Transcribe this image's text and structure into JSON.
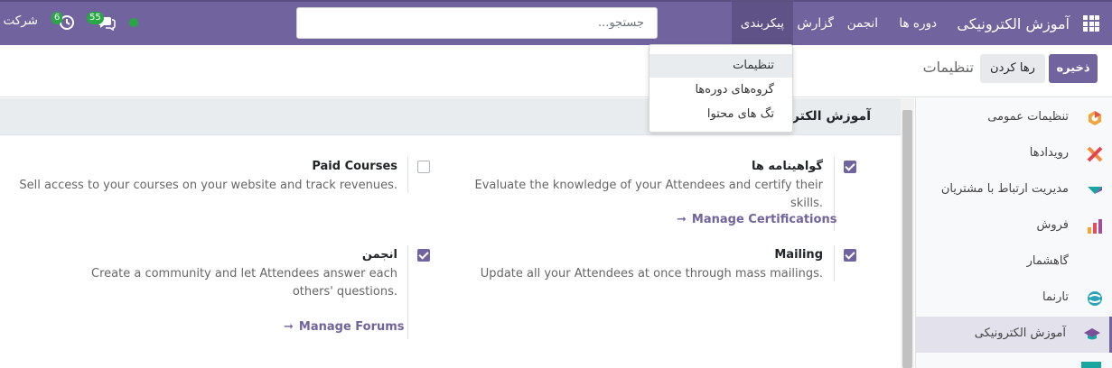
{
  "navbar": {
    "brand": "آموزش الکترونیکی",
    "menus": [
      "دوره ها",
      "انجمن",
      "گزارش",
      "پیکربندی"
    ],
    "chat_count": "55",
    "activity_count": "6",
    "company": "شرکت من",
    "icons": [
      "apps-grid-icon",
      "chat-icon",
      "activity-clock-icon"
    ],
    "accent_color": "#71639e"
  },
  "control": {
    "save_label": "ذخیره",
    "discard_label": "رها کردن",
    "title": "تنظیمات",
    "search_value": "جستجو..."
  },
  "dropdown": {
    "items": [
      "تنظیمات",
      "گروه‌های دوره‌ها",
      "تگ های محتوا"
    ]
  },
  "sidebar": {
    "items": [
      {
        "label": "تنظیمات عمومی",
        "icon": "general-settings-icon"
      },
      {
        "label": "رویدادها",
        "icon": "events-icon"
      },
      {
        "label": "مدیریت ارتباط با مشتریان",
        "icon": "crm-icon"
      },
      {
        "label": "فروش",
        "icon": "sales-icon"
      },
      {
        "label": "گاهشمار",
        "icon": "calendar-icon"
      },
      {
        "label": "تارنما",
        "icon": "website-icon"
      },
      {
        "label": "آموزش الکترونیکی",
        "icon": "elearning-icon"
      }
    ]
  },
  "section": {
    "title": "آموزش الکترونیکی"
  },
  "options": {
    "certifications": {
      "title": "گواهینامه ها",
      "desc": "Evaluate the knowledge of your Attendees and certify their skills.",
      "link": "Manage Certifications",
      "checked": true
    },
    "paid": {
      "title": "Paid Courses",
      "desc": "Sell access to your courses on your website and track revenues.",
      "checked": false
    },
    "mailing": {
      "title": "Mailing",
      "desc": "Update all your Attendees at once through mass mailings.",
      "checked": true
    },
    "forum": {
      "title": "انجمن",
      "desc": "Create a community and let Attendees answer each others' questions.",
      "link": "Manage Forums",
      "checked": true
    }
  }
}
